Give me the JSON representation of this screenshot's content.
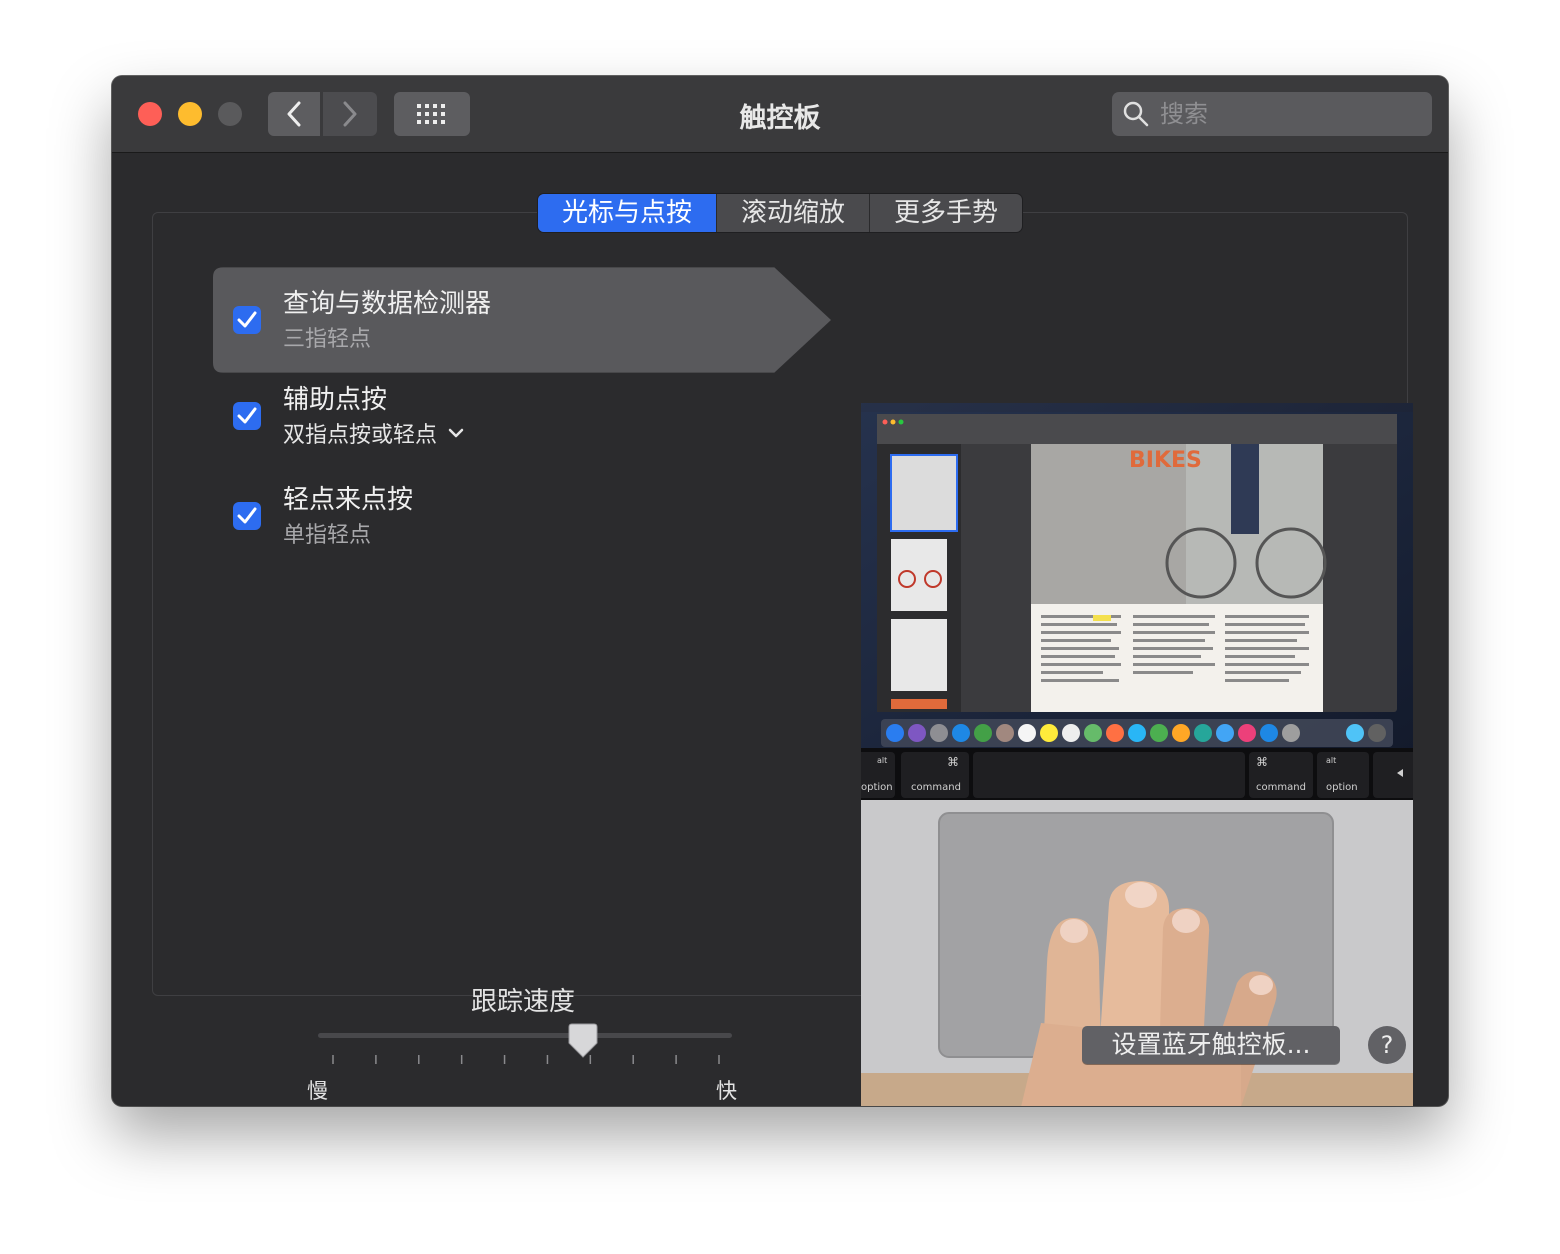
{
  "window": {
    "title": "触控板",
    "search_placeholder": "搜索"
  },
  "tabs": [
    {
      "label": "光标与点按",
      "active": true
    },
    {
      "label": "滚动缩放",
      "active": false
    },
    {
      "label": "更多手势",
      "active": false
    }
  ],
  "options": [
    {
      "title": "查询与数据检测器",
      "subtitle": "三指轻点",
      "checked": true,
      "selected": true
    },
    {
      "title": "辅助点按",
      "subtitle": "双指点按或轻点",
      "checked": true,
      "selected": false,
      "has_dropdown": true
    },
    {
      "title": "轻点来点按",
      "subtitle": "单指轻点",
      "checked": true,
      "selected": false
    }
  ],
  "tracking": {
    "label": "跟踪速度",
    "slow": "慢",
    "fast": "快",
    "level_fraction": 0.64,
    "tick_count": 10
  },
  "preview": {
    "keyboard": {
      "left_alt": "alt",
      "left_option": "option",
      "left_cmd_symbol": "⌘",
      "left_command": "command",
      "right_cmd_symbol": "⌘",
      "right_command": "command",
      "right_alt": "alt",
      "right_option": "option"
    },
    "doc_title": "BIKES"
  },
  "footer": {
    "bluetooth_button": "设置蓝牙触控板...",
    "help_button": "?"
  },
  "colors": {
    "accent": "#2d6cf0",
    "window_bg": "#2b2b2d",
    "titlebar_bg": "#3a3a3c"
  }
}
